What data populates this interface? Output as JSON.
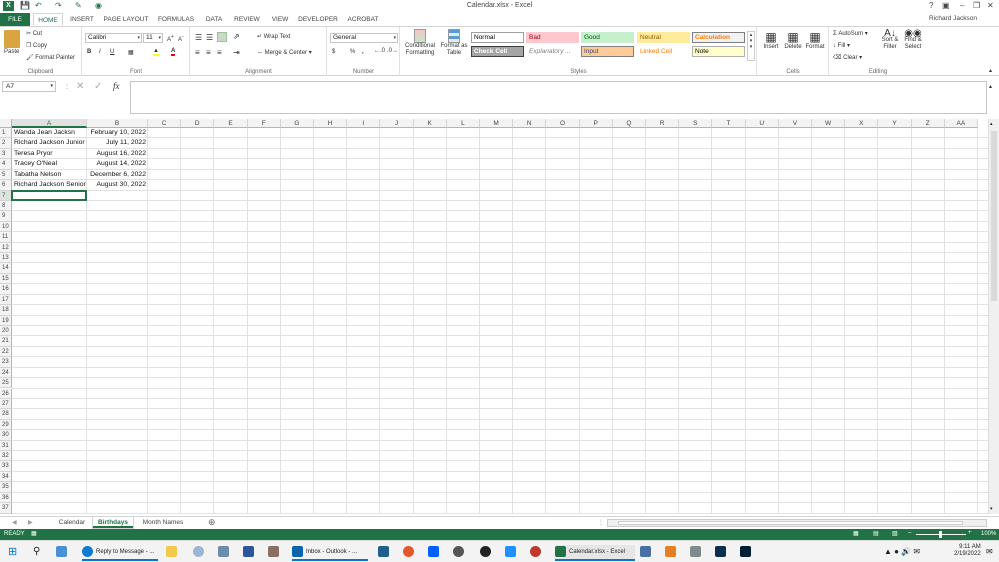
{
  "app": {
    "title": "Calendar.xlsx - Excel",
    "user": "Richard Jackson"
  },
  "colors": {
    "accent": "#217346",
    "selection": "#217346"
  },
  "tabs": [
    "FILE",
    "HOME",
    "INSERT",
    "PAGE LAYOUT",
    "FORMULAS",
    "DATA",
    "REVIEW",
    "VIEW",
    "DEVELOPER",
    "ACROBAT"
  ],
  "ribbon": {
    "clipboard": {
      "label": "Clipboard",
      "paste": "Paste",
      "cut": "Cut",
      "copy": "Copy",
      "format_painter": "Format Painter"
    },
    "font": {
      "label": "Font",
      "family": "Calibri",
      "size": "11",
      "bold": "B",
      "italic": "I",
      "underline": "U"
    },
    "alignment": {
      "label": "Alignment",
      "wrap": "Wrap Text",
      "merge": "Merge & Center"
    },
    "number": {
      "label": "Number",
      "format": "General",
      "currency": "$",
      "percent": "%",
      "comma": ","
    },
    "styles": {
      "label": "Styles",
      "conditional": "Conditional Formatting",
      "format_as": "Format as Table",
      "items": [
        {
          "name": "Normal",
          "bg": "#ffffff",
          "fg": "#000000",
          "border": "#9e9e9e"
        },
        {
          "name": "Bad",
          "bg": "#ffc7ce",
          "fg": "#9c0006",
          "border": "#ffc7ce"
        },
        {
          "name": "Good",
          "bg": "#c6efce",
          "fg": "#006100",
          "border": "#c6efce"
        },
        {
          "name": "Neutral",
          "bg": "#ffeb9c",
          "fg": "#9c5700",
          "border": "#ffeb9c"
        },
        {
          "name": "Calculation",
          "bg": "#f2f2f2",
          "fg": "#fa7d00",
          "border": "#7f7f7f"
        },
        {
          "name": "Check Cell",
          "bg": "#a5a5a5",
          "fg": "#ffffff",
          "border": "#3f3f3f"
        },
        {
          "name": "Explanatory ...",
          "bg": "#ffffff",
          "fg": "#7f7f7f",
          "border": "#ffffff"
        },
        {
          "name": "Input",
          "bg": "#ffcc99",
          "fg": "#3f3f76",
          "border": "#7f7f7f"
        },
        {
          "name": "Linked Cell",
          "bg": "#ffffff",
          "fg": "#fa7d00",
          "border": "#ffffff"
        },
        {
          "name": "Note",
          "bg": "#ffffcc",
          "fg": "#000000",
          "border": "#b2b2b2"
        }
      ]
    },
    "cells": {
      "label": "Cells",
      "insert": "Insert",
      "delete": "Delete",
      "format": "Format"
    },
    "editing": {
      "label": "Editing",
      "autosum": "AutoSum",
      "fill": "Fill",
      "clear": "Clear",
      "sort": "Sort & Filter",
      "find": "Find & Select"
    }
  },
  "formula_bar": {
    "name_box": "A7",
    "fx": "fx",
    "value": ""
  },
  "columns": [
    "A",
    "B",
    "C",
    "D",
    "E",
    "F",
    "G",
    "H",
    "I",
    "J",
    "K",
    "L",
    "M",
    "N",
    "O",
    "P",
    "Q",
    "R",
    "S",
    "T",
    "U",
    "V",
    "W",
    "X",
    "Y",
    "Z",
    "AA"
  ],
  "rows": [
    {
      "a": "Wanda Jean Jacksn",
      "b": "February 10, 2022"
    },
    {
      "a": "Richard Jackson Junior",
      "b": "July 11, 2022"
    },
    {
      "a": "Teresa Pryor",
      "b": "August 16, 2022"
    },
    {
      "a": "Tracey O'Neal",
      "b": "August 14, 2022"
    },
    {
      "a": "Tabatha Nelson",
      "b": "December 6, 2022"
    },
    {
      "a": "Richard Jackson Senior",
      "b": "August 30, 2022"
    }
  ],
  "row_count": 37,
  "active_cell": "A7",
  "sheets": [
    {
      "name": "Calendar",
      "active": false
    },
    {
      "name": "Birthdays",
      "active": true
    },
    {
      "name": "Month Names",
      "active": false
    }
  ],
  "status": {
    "mode": "READY",
    "zoom": "100%"
  },
  "taskbar": {
    "items": [
      {
        "label": "Reply to Message - ...",
        "color": "#0b7bd4"
      },
      {
        "label": "Inbox - Outlook - ...",
        "color": "#0a64ad"
      },
      {
        "label": "Calendar.xlsx - Excel",
        "color": "#217346"
      }
    ],
    "time": "9:11 AM",
    "date": "2/19/2022"
  }
}
